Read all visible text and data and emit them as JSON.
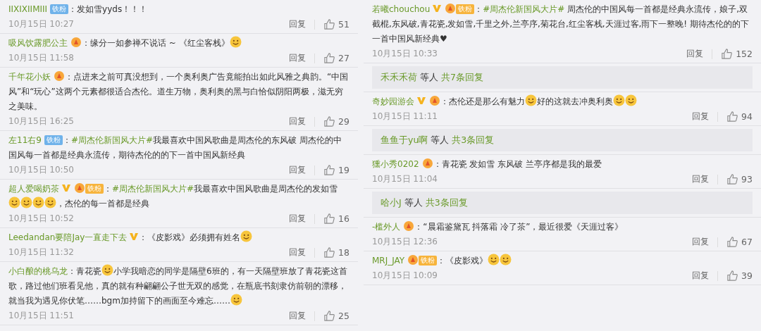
{
  "columns": [
    {
      "items": [
        {
          "kind": "comment",
          "user": "IIXIXIIMIII",
          "verified": false,
          "badges": [
            {
              "kind": "blue",
              "label": "铁粉"
            }
          ],
          "parts": [
            {
              "kind": "text",
              "text": "：发如雪yyds！！！"
            }
          ],
          "time": "10月15日 10:27",
          "reply": "回复",
          "likes": "51"
        },
        {
          "kind": "comment",
          "user": "吸风饮露肥公主",
          "verified": false,
          "badges": [
            {
              "kind": "orange"
            }
          ],
          "parts": [
            {
              "kind": "text",
              "text": "：缘分一如参禅不说话 ~ 《红尘客栈》"
            },
            {
              "kind": "emoji"
            }
          ],
          "time": "10月15日 11:58",
          "reply": "回复",
          "likes": "27"
        },
        {
          "kind": "comment",
          "user": "千年花小妖",
          "verified": false,
          "badges": [
            {
              "kind": "orange"
            }
          ],
          "parts": [
            {
              "kind": "text",
              "text": "：点进来之前可真没想到，一个奥利奥广告竟能拍出如此风雅之典韵。“中国风”和“玩心”这两个元素都很适合杰伦。道生万物，奥利奥的黑与白恰似阴阳两极，滋无穷之美味。"
            }
          ],
          "time": "10月15日 16:25",
          "reply": "回复",
          "likes": "29"
        },
        {
          "kind": "comment",
          "user": "左11右9",
          "verified": false,
          "badges": [
            {
              "kind": "blue",
              "label": "铁粉"
            }
          ],
          "parts": [
            {
              "kind": "text",
              "text": "："
            },
            {
              "kind": "topic",
              "text": "#周杰伦新国风大片#"
            },
            {
              "kind": "text",
              "text": "我最喜欢中国风歌曲是周杰伦的东风破 周杰伦的中国风每一首都是经典永流传，期待杰伦的的下一首中国风新经典"
            }
          ],
          "time": "10月15日 10:50",
          "reply": "回复",
          "likes": "19"
        },
        {
          "kind": "comment",
          "user": "超人爱喝奶茶",
          "verified": true,
          "badges": [
            {
              "kind": "orange",
              "label": "铁粉"
            }
          ],
          "parts": [
            {
              "kind": "text",
              "text": "："
            },
            {
              "kind": "topic",
              "text": "#周杰伦新国风大片#"
            },
            {
              "kind": "text",
              "text": "我最喜欢中国风歌曲是周杰伦的发如雪"
            },
            {
              "kind": "emoji"
            },
            {
              "kind": "emoji"
            },
            {
              "kind": "emoji"
            },
            {
              "kind": "emoji"
            },
            {
              "kind": "text",
              "text": "，杰伦的每一首都是经典"
            }
          ],
          "time": "10月15日 10:52",
          "reply": "回复",
          "likes": "16"
        },
        {
          "kind": "comment",
          "user": "Leedandan要陪Jay一直走下去",
          "verified": true,
          "parts": [
            {
              "kind": "text",
              "text": "：《皮影戏》必须拥有姓名"
            },
            {
              "kind": "emoji"
            }
          ],
          "time": "10月15日 11:32",
          "reply": "回复",
          "likes": "18"
        },
        {
          "kind": "comment",
          "user": "小白酿的桃乌龙",
          "verified": false,
          "parts": [
            {
              "kind": "text",
              "text": "：青花瓷"
            },
            {
              "kind": "emoji"
            },
            {
              "kind": "text",
              "text": "小学我暗恋的同学是隔壁6班的，有一天隔壁班放了青花瓷这首歌，路过他们班看见他，真的就有种翩翩公子世无双的感觉，在瓶底书刻隶仿前朝的漂移，就当我为遇见你伏笔……bgm加持留下的画面至今难忘……"
            },
            {
              "kind": "emoji"
            }
          ],
          "time": "10月15日 11:51",
          "reply": "回复",
          "likes": "25"
        }
      ]
    },
    {
      "items": [
        {
          "kind": "comment",
          "user": "若曦chouchou",
          "verified": true,
          "badges": [
            {
              "kind": "orange",
              "label": "铁粉"
            }
          ],
          "parts": [
            {
              "kind": "text",
              "text": "："
            },
            {
              "kind": "topic",
              "text": "#周杰伦新国风大片#"
            },
            {
              "kind": "text",
              "text": " 周杰伦的中国风每一首都是经典永流传，娘子,双截棍,东风破,青花瓷,发如雪,千里之外,兰亭序,菊花台,红尘客栈,天涯过客,雨下一整晚! 期待杰伦的的下一首中国风新经典♥"
            }
          ],
          "time": "10月15日 10:33",
          "reply": "回复",
          "likes": "152"
        },
        {
          "kind": "more_replies",
          "user": "禾禾禾荷",
          "middle": "等人",
          "count": "共7条回复"
        },
        {
          "kind": "comment",
          "user": "奇妙园游会",
          "verified": true,
          "badges": [
            {
              "kind": "orange"
            }
          ],
          "parts": [
            {
              "kind": "text",
              "text": "：杰伦还是那么有魅力"
            },
            {
              "kind": "emoji"
            },
            {
              "kind": "text",
              "text": "好的这就去冲奥利奥"
            },
            {
              "kind": "emoji"
            },
            {
              "kind": "emoji"
            }
          ],
          "time": "10月15日 11:11",
          "reply": "回复",
          "likes": "94"
        },
        {
          "kind": "more_replies",
          "user": "鱼鱼于yu啊",
          "middle": "等人",
          "count": "共3条回复"
        },
        {
          "kind": "comment",
          "user": "獯小秀0202",
          "verified": false,
          "badges": [
            {
              "kind": "orange"
            }
          ],
          "parts": [
            {
              "kind": "text",
              "text": "：青花瓷 发如雪 东风破 兰亭序都是我的最爱"
            }
          ],
          "time": "10月15日 11:04",
          "reply": "回复",
          "likes": "93"
        },
        {
          "kind": "more_replies",
          "user": "哈小J",
          "middle": "等人",
          "count": "共3条回复"
        },
        {
          "kind": "comment",
          "user": "-槛外人",
          "verified": false,
          "badges": [
            {
              "kind": "orange"
            }
          ],
          "parts": [
            {
              "kind": "text",
              "text": "：“晨霜鉴黛瓦 抖落霜 冷了茶”，最近很爱《天涯过客》"
            }
          ],
          "time": "10月15日 12:36",
          "reply": "回复",
          "likes": "67"
        },
        {
          "kind": "comment",
          "user": "MRJ_JAY",
          "verified": false,
          "badges": [
            {
              "kind": "orange",
              "label": "铁粉"
            }
          ],
          "parts": [
            {
              "kind": "text",
              "text": "：《皮影戏》"
            },
            {
              "kind": "emoji"
            },
            {
              "kind": "emoji"
            }
          ],
          "time": "10月15日 10:09",
          "reply": "回复",
          "likes": "39"
        }
      ]
    }
  ]
}
